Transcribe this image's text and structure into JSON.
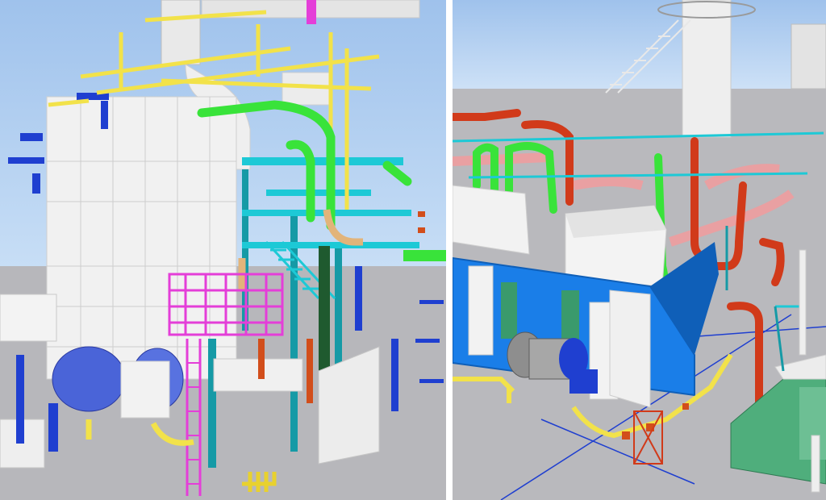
{
  "colors": {
    "sky": "#a9c8ee",
    "sky_light": "#cfe2f7",
    "floor": "#b9b9bd",
    "floor_dark": "#a6a6aa",
    "white_equipment": "#f2f2f2",
    "white_shadow": "#d7d7d7",
    "pipe_green": "#39e33a",
    "pipe_cyan": "#1dc9d6",
    "pipe_teal": "#159aa6",
    "pipe_yellow": "#f2e24a",
    "pipe_tan": "#e2b47a",
    "pipe_blue": "#1f3fd0",
    "pipe_orange": "#d24e1b",
    "pipe_red": "#d13a1a",
    "pipe_pink": "#e9a0a2",
    "platform_magenta": "#e43ed8",
    "boiler_blue": "#1a7ee8",
    "boiler_blue_dark": "#0f5fb8",
    "green_panel": "#4fae7c",
    "dark_green": "#1f5a2f"
  },
  "panels": [
    {
      "view": "left-3d-plant-view"
    },
    {
      "view": "right-3d-boiler-view"
    }
  ]
}
